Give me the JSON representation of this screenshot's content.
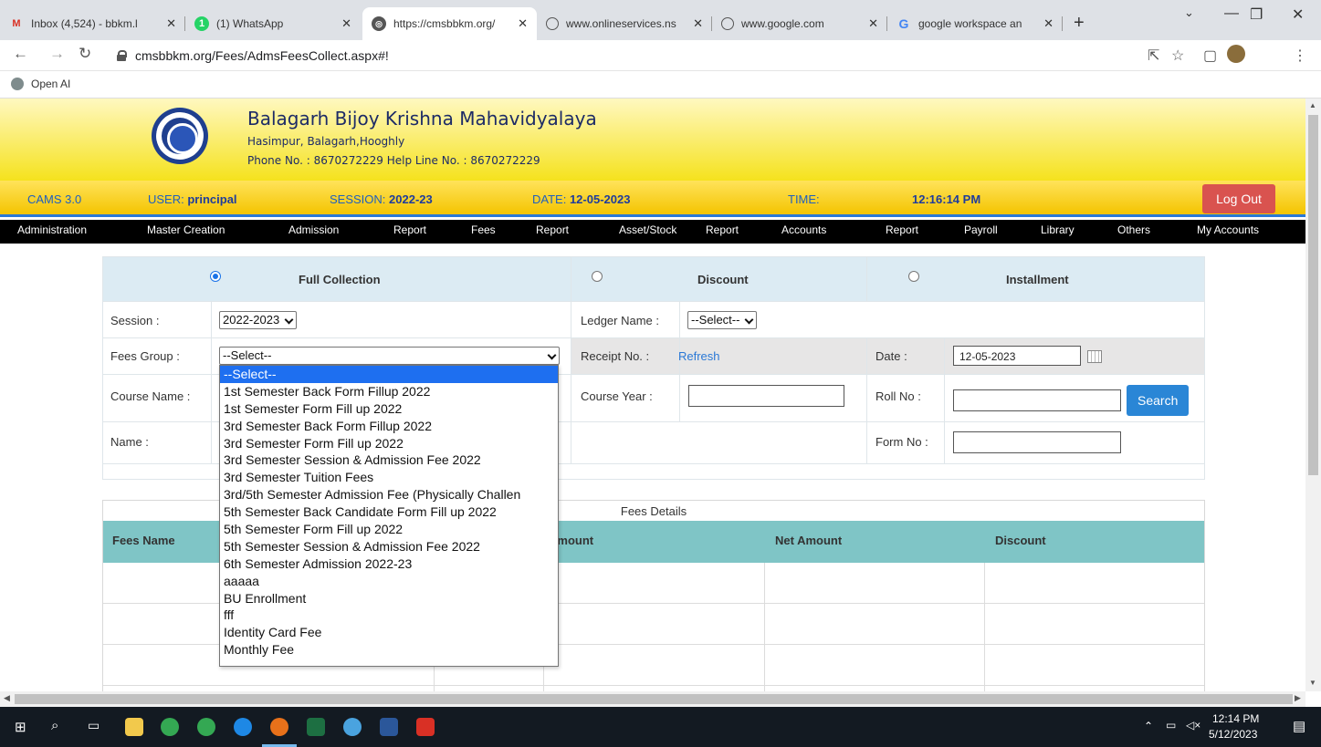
{
  "browser": {
    "tabs": [
      {
        "label": "Inbox (4,524) - bbkm.l",
        "icon": "gmail-icon"
      },
      {
        "label": "(1) WhatsApp",
        "icon": "whatsapp-icon"
      },
      {
        "label": "https://cmsbbkm.org/",
        "icon": "site-icon"
      },
      {
        "label": "www.onlineservices.ns",
        "icon": "globe-icon"
      },
      {
        "label": "www.google.com",
        "icon": "globe-icon"
      },
      {
        "label": "google workspace an",
        "icon": "google-icon"
      }
    ],
    "url": "cmsbbkm.org/Fees/AdmsFeesCollect.aspx#!",
    "bookmark": "Open AI"
  },
  "college": {
    "name": "Balagarh Bijoy Krishna Mahavidyalaya",
    "address": "Hasimpur, Balagarh,Hooghly",
    "phone": "Phone No. : 8670272229  Help Line No. : 8670272229"
  },
  "infobar": {
    "version": "CAMS 3.0",
    "user_label": "USER:",
    "user": "principal",
    "session_label": "SESSION:",
    "session": "2022-23",
    "date_label": "DATE:",
    "date": "12-05-2023",
    "time_label": "TIME:",
    "time": "12:16:14 PM",
    "logout": "Log Out"
  },
  "menu": [
    "Administration",
    "Master Creation",
    "Admission",
    "Report",
    "Fees",
    "Report",
    "Asset/Stock",
    "Report",
    "Accounts",
    "Report",
    "Payroll",
    "Library",
    "Others",
    "My Accounts"
  ],
  "modes": {
    "full": "Full Collection",
    "discount": "Discount",
    "installment": "Installment",
    "selected": "full"
  },
  "form": {
    "session_label": "Session :",
    "session_value": "2022-2023",
    "ledger_label": "Ledger Name :",
    "ledger_value": "--Select--",
    "fees_group_label": "Fees Group :",
    "fees_group_value": "--Select--",
    "receipt_label": "Receipt No. :",
    "refresh": "Refresh",
    "date_label": "Date :",
    "date_value": "12-05-2023",
    "course_name_label": "Course Name :",
    "course_year_label": "Course Year :",
    "roll_label": "Roll No :",
    "search": "Search",
    "name_label": "Name :",
    "form_no_label": "Form No :"
  },
  "fees_group_options": [
    "--Select--",
    "1st Semester Back Form Fillup 2022",
    "1st Semester Form Fill up 2022",
    "3rd Semester Back Form Fillup 2022",
    "3rd Semester Form Fill up 2022",
    "3rd Semester Session & Admission Fee 2022",
    "3rd Semester Tuition Fees",
    "3rd/5th Semester Admission Fee (Physically Challen",
    "5th Semester Back Candidate Form Fill up 2022",
    "5th Semester Form Fill up 2022",
    "5th Semester Session & Admission Fee 2022",
    "6th Semester Admission 2022-23",
    "aaaaa",
    "BU Enrollment",
    "fff",
    "Identity Card Fee",
    "Monthly Fee"
  ],
  "fees_table": {
    "caption": "Fees Details",
    "headers": [
      "Fees Name",
      "Amount",
      "Net Amount",
      "Discount"
    ]
  },
  "taskbar": {
    "time": "12:14 PM",
    "date": "5/12/2023"
  }
}
